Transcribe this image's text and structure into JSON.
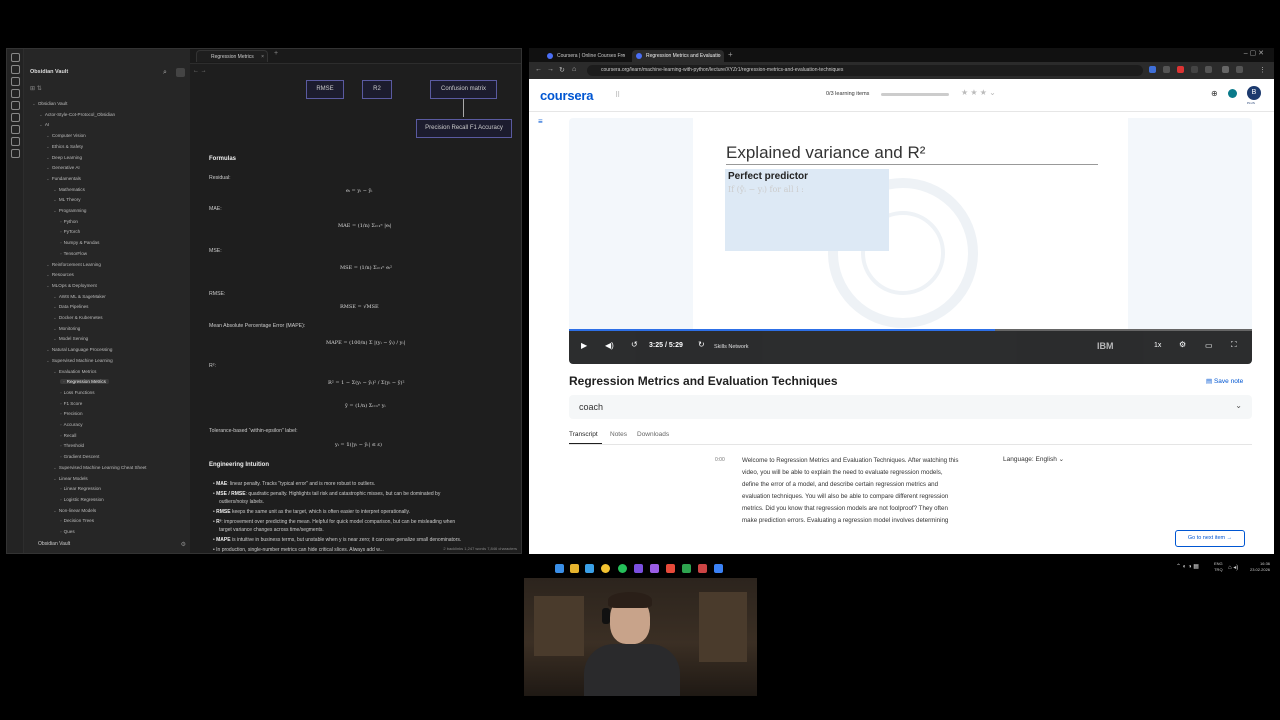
{
  "obsidian": {
    "vault_name": "Obsidian Vault",
    "tab_title": "Regression Metrics",
    "tree": [
      {
        "label": "Obsidian Vault",
        "depth": 0
      },
      {
        "label": "Actor-Style-Cot-Protocol_Obsidian",
        "depth": 1
      },
      {
        "label": "AI",
        "depth": 1
      },
      {
        "label": "Computer Vision",
        "depth": 2
      },
      {
        "label": "Ethics & Safety",
        "depth": 2
      },
      {
        "label": "Deep Learning",
        "depth": 2
      },
      {
        "label": "Generative AI",
        "depth": 2
      },
      {
        "label": "Fundamentals",
        "depth": 2
      },
      {
        "label": "Mathematics",
        "depth": 3
      },
      {
        "label": "ML Theory",
        "depth": 3
      },
      {
        "label": "Programming",
        "depth": 3
      },
      {
        "label": "Python",
        "depth": 4
      },
      {
        "label": "PyTorch",
        "depth": 4
      },
      {
        "label": "Numpy & Pandas",
        "depth": 4
      },
      {
        "label": "TensorFlow",
        "depth": 4
      },
      {
        "label": "Reinforcement Learning",
        "depth": 2
      },
      {
        "label": "Resources",
        "depth": 2
      },
      {
        "label": "MLOps & Deployment",
        "depth": 2
      },
      {
        "label": "AWS ML & SageMaker",
        "depth": 3
      },
      {
        "label": "Data Pipelines",
        "depth": 3
      },
      {
        "label": "Docker & Kubernetes",
        "depth": 3
      },
      {
        "label": "Monitoring",
        "depth": 3
      },
      {
        "label": "Model Serving",
        "depth": 3
      },
      {
        "label": "Natural Language Processing",
        "depth": 2
      },
      {
        "label": "Supervised Machine Learning",
        "depth": 2
      },
      {
        "label": "Evaluation Metrics",
        "depth": 3
      },
      {
        "label": "Regression Metrics",
        "depth": 4,
        "active": true
      },
      {
        "label": "Loss Functions",
        "depth": 4
      },
      {
        "label": "F1 Score",
        "depth": 4
      },
      {
        "label": "Precision",
        "depth": 4
      },
      {
        "label": "Accuracy",
        "depth": 4
      },
      {
        "label": "Recall",
        "depth": 4
      },
      {
        "label": "Threshold",
        "depth": 4
      },
      {
        "label": "Gradient Descent",
        "depth": 4
      },
      {
        "label": "Supervised Machine Learning Cheat Sheet",
        "depth": 3
      },
      {
        "label": "Linear Models",
        "depth": 3
      },
      {
        "label": "Linear Regression",
        "depth": 4
      },
      {
        "label": "Logistic Regression",
        "depth": 4
      },
      {
        "label": "Non-linear Models",
        "depth": 3
      },
      {
        "label": "Decision Trees",
        "depth": 4
      },
      {
        "label": "Ques",
        "depth": 4
      }
    ],
    "diagram": {
      "mse": "RMSE",
      "r2": "R2",
      "confusion": "Confusion matrix",
      "prf": "Precision Recall F1 Accuracy"
    },
    "note": {
      "formulas_heading": "Formulas",
      "residual": "Residual:",
      "residual_f": "eᵢ = yᵢ − ŷᵢ",
      "mae": "MAE:",
      "mae_f": "MAE = (1/n) Σᵢ₌₁ⁿ |eᵢ|",
      "mse": "MSE:",
      "mse_f": "MSE = (1/n) Σᵢ₌₁ⁿ eᵢ²",
      "rmse": "RMSE:",
      "rmse_f": "RMSE = √MSE",
      "mape": "Mean Absolute Percentage Error (MAPE):",
      "mape_f": "MAPE = (100/n) Σ |(yᵢ − ŷᵢ) / yᵢ|",
      "r2": "R²:",
      "r2_f": "R² = 1 − Σ(yᵢ − ŷᵢ)² / Σ(yᵢ − ȳ)²",
      "ybar_f": "ȳ = (1/n) Σᵢ₌₁ⁿ yᵢ",
      "tol": "Tolerance-based “within-epsilon” label:",
      "tol_f": "yᵢ = 𝟙(|yᵢ − ŷᵢ| ≤ ε)",
      "eng_heading": "Engineering Intuition",
      "b1_bold": "MAE",
      "b1": ": linear penalty. Tracks \"typical error\" and is more robust to outliers.",
      "b2_bold": "MSE / RMSE",
      "b2": ": quadratic penalty. Highlights tail risk and catastrophic misses, but can be dominated by",
      "b2b": "outliers/noisy labels.",
      "b3_bold": "RMSE",
      "b3": " keeps the same unit as the target, which is often easier to interpret operationally.",
      "b4_bold": "R²",
      "b4": ": improvement over predicting the mean. Helpful for quick model comparison, but can be misleading when",
      "b4b": "target variance changes across time/segments.",
      "b5_bold": "MAPE",
      "b5": " is intuitive in business terms, but unstable when y is near zero; it can over-penalize small denominators.",
      "b6": "In production, single-number metrics can hide critical slices. Always add w..."
    },
    "status": "2 backlinks   1,247 words   7,846 characters"
  },
  "chrome": {
    "tab1": "Coursera | Online Courses Fro",
    "tab2": "Regression Metrics and Evaluatio",
    "url": "coursera.org/learn/machine-learning-with-python/lecture/XYZr1/regression-metrics-and-evaluation-techniques",
    "logo": "coursera",
    "progress_label": "0/3 learning items",
    "avatar_letter": "B",
    "avatar_badge": "PLUS"
  },
  "video": {
    "slide_title": "Explained variance and R²",
    "box_title": "Perfect predictor",
    "box_line": "If (ŷᵢ − yᵢ) for all i :",
    "time": "3:25 / 5:29",
    "watermark": "Skills Network",
    "ibm": "IBM",
    "speed": "1x",
    "progress": 0.624
  },
  "lecture": {
    "title": "Regression Metrics and Evaluation Techniques",
    "save_note": "Save note",
    "coach": "coach",
    "tabs": [
      "Transcript",
      "Notes",
      "Downloads"
    ],
    "timestamp": "0:00",
    "transcript": [
      "Welcome to Regression Metrics and Evaluation Techniques. After watching this",
      "video, you will be able to explain the need to evaluate regression models,",
      "define the error of a model, and describe certain regression metrics and",
      "evaluation techniques. You will also be able to compare different regression",
      "metrics. Did you know that regression models are not foolproof? They often",
      "make prediction errors. Evaluating a regression model involves determining"
    ],
    "language_label": "Language:",
    "language_value": "English",
    "next_button": "Go to next item"
  },
  "taskbar": {
    "lang": "ENG",
    "lang2": "TRQ",
    "time": "16:36",
    "date": "23.02.2026"
  }
}
